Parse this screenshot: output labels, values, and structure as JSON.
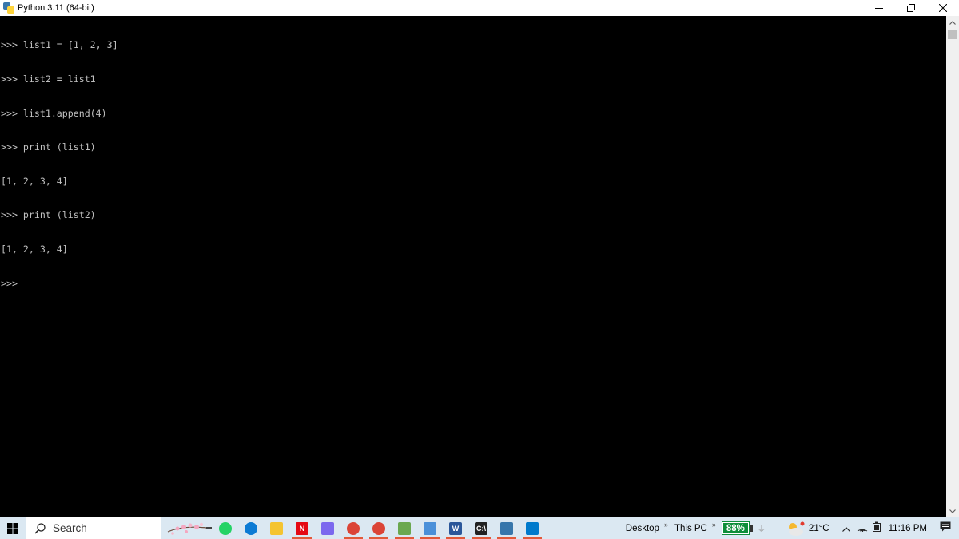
{
  "window": {
    "title": "Python 3.11 (64-bit)",
    "controls": [
      "minimize",
      "restore",
      "close"
    ]
  },
  "console": {
    "lines": [
      ">>> list1 = [1, 2, 3]",
      ">>> list2 = list1",
      ">>> list1.append(4)",
      ">>> print (list1)",
      "[1, 2, 3, 4]",
      ">>> print (list2)",
      "[1, 2, 3, 4]",
      ">>>"
    ]
  },
  "taskbar": {
    "search_label": "Search",
    "pinned_icons": [
      {
        "name": "whatsapp-icon",
        "color": "#25d366"
      },
      {
        "name": "edge-icon",
        "color": "#0c7bd4"
      },
      {
        "name": "file-explorer-icon",
        "color": "#f4c430"
      },
      {
        "name": "netflix-icon",
        "color": "#e50914",
        "text": "N"
      },
      {
        "name": "app-gradient-icon",
        "color": "#7b68ee"
      },
      {
        "name": "chrome-icon",
        "color": "#db4437"
      },
      {
        "name": "chrome-profile-icon",
        "color": "#db4437"
      },
      {
        "name": "notepad-icon",
        "color": "#6aa84f"
      },
      {
        "name": "notepad2-icon",
        "color": "#4a90d9"
      },
      {
        "name": "word-icon",
        "color": "#2b579a",
        "text": "W"
      },
      {
        "name": "cmd-icon",
        "color": "#222222",
        "text": "C:\\"
      },
      {
        "name": "python-icon",
        "color": "#3776ab"
      },
      {
        "name": "vscode-icon",
        "color": "#007acc"
      }
    ],
    "toolbars": {
      "desktop": "Desktop",
      "this_pc": "This PC",
      "chevron": "»"
    },
    "battery": "88%",
    "temperature": "21°C",
    "time": "11:16 PM"
  }
}
